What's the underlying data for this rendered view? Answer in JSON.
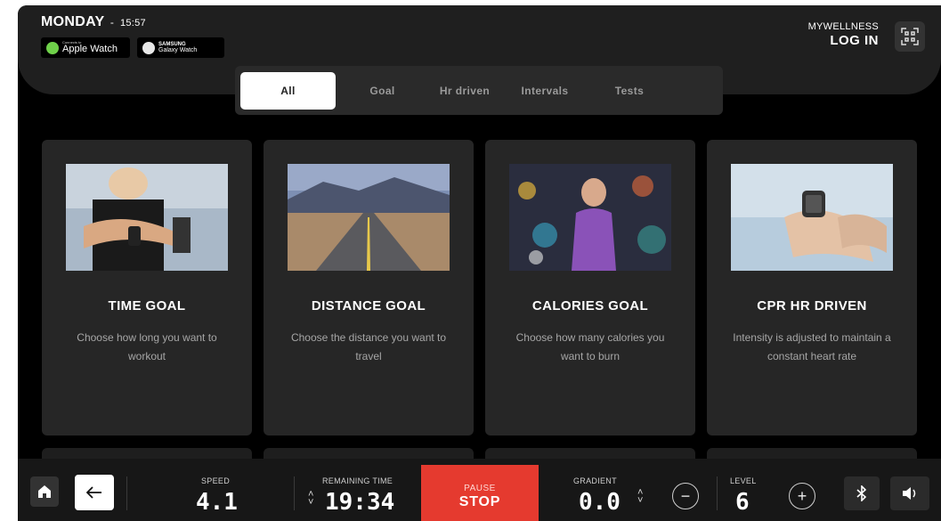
{
  "header": {
    "day": "MONDAY",
    "separator": "-",
    "time": "15:57",
    "apple_badge": {
      "small": "Connects to",
      "label": "Apple Watch"
    },
    "samsung_badge": {
      "small": "SAMSUNG",
      "label": "Galaxy Watch"
    },
    "mywellness": "MYWELLNESS",
    "login": "LOG IN"
  },
  "tabs": [
    {
      "label": "All",
      "active": true
    },
    {
      "label": "Goal",
      "active": false
    },
    {
      "label": "Hr driven",
      "active": false
    },
    {
      "label": "Intervals",
      "active": false
    },
    {
      "label": "Tests",
      "active": false
    }
  ],
  "cards": [
    {
      "title": "TIME GOAL",
      "desc": "Choose how long you want to workout"
    },
    {
      "title": "DISTANCE GOAL",
      "desc": "Choose the distance you want to travel"
    },
    {
      "title": "CALORIES GOAL",
      "desc": "Choose how many calories you want to burn"
    },
    {
      "title": "CPR HR DRIVEN",
      "desc": "Intensity is adjusted to maintain a constant heart rate"
    }
  ],
  "bottom": {
    "speed_label": "SPEED",
    "speed": "4.1",
    "remaining_label": "REMAINING TIME",
    "remaining": "19:34",
    "pause_label": "PAUSE",
    "stop_label": "STOP",
    "gradient_label": "GRADIENT",
    "gradient": "0.0",
    "level_label": "LEVEL",
    "level": "6"
  },
  "colors": {
    "accent": "#e53a2f",
    "card": "#262626",
    "background": "#000000"
  }
}
